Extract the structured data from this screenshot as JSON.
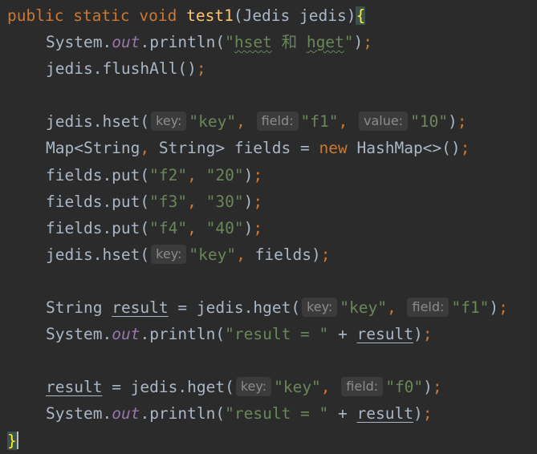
{
  "kw": {
    "public": "public",
    "static": "static",
    "void": "void",
    "new": "new"
  },
  "method_name": "test1",
  "param_type": "Jedis",
  "param_name": "jedis",
  "system": "System",
  "out_field": "out",
  "println": "println",
  "str": {
    "hset_hget": "\"hset 和 hget\"",
    "key": "\"key\"",
    "f1": "\"f1\"",
    "ten": "\"10\"",
    "f2": "\"f2\"",
    "twenty": "\"20\"",
    "f3": "\"f3\"",
    "thirty": "\"30\"",
    "f4": "\"f4\"",
    "forty": "\"40\"",
    "result_eq": "\"result = \"",
    "f0": "\"f0\""
  },
  "jedis": "jedis",
  "flushAll": "flushAll",
  "hset": "hset",
  "hget": "hget",
  "map_decl": "Map<String",
  "string_gt": " String> ",
  "fields": "fields",
  "fields_put": "fields.put(",
  "hashmap": "HashMap<>()",
  "string_type": "String",
  "result": "result",
  "hints": {
    "key": "key:",
    "field": "field:",
    "value": "value:"
  }
}
